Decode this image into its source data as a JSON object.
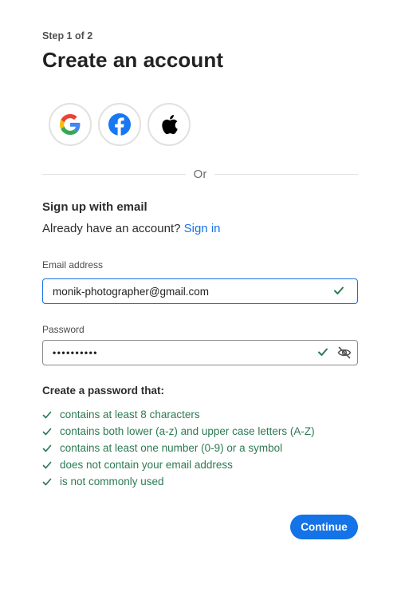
{
  "step": "Step 1 of 2",
  "title": "Create an account",
  "social": {
    "google_icon": "google-icon",
    "facebook_icon": "facebook-icon",
    "apple_icon": "apple-icon"
  },
  "divider_text": "Or",
  "signup": {
    "heading": "Sign up with email",
    "already_text": "Already have an account?",
    "signin_link": "Sign in"
  },
  "email": {
    "label": "Email address",
    "value": "monik-photographer@gmail.com"
  },
  "password": {
    "label": "Password",
    "value": "••••••••••"
  },
  "rules": {
    "title": "Create a password that:",
    "items": [
      "contains at least 8 characters",
      "contains both lower (a-z) and upper case letters (A-Z)",
      "contains at least one number (0-9) or a symbol",
      "does not contain your email address",
      "is not commonly used"
    ]
  },
  "continue_label": "Continue",
  "colors": {
    "accent": "#1473e6",
    "success": "#2d7a53",
    "facebook": "#1877f2"
  }
}
